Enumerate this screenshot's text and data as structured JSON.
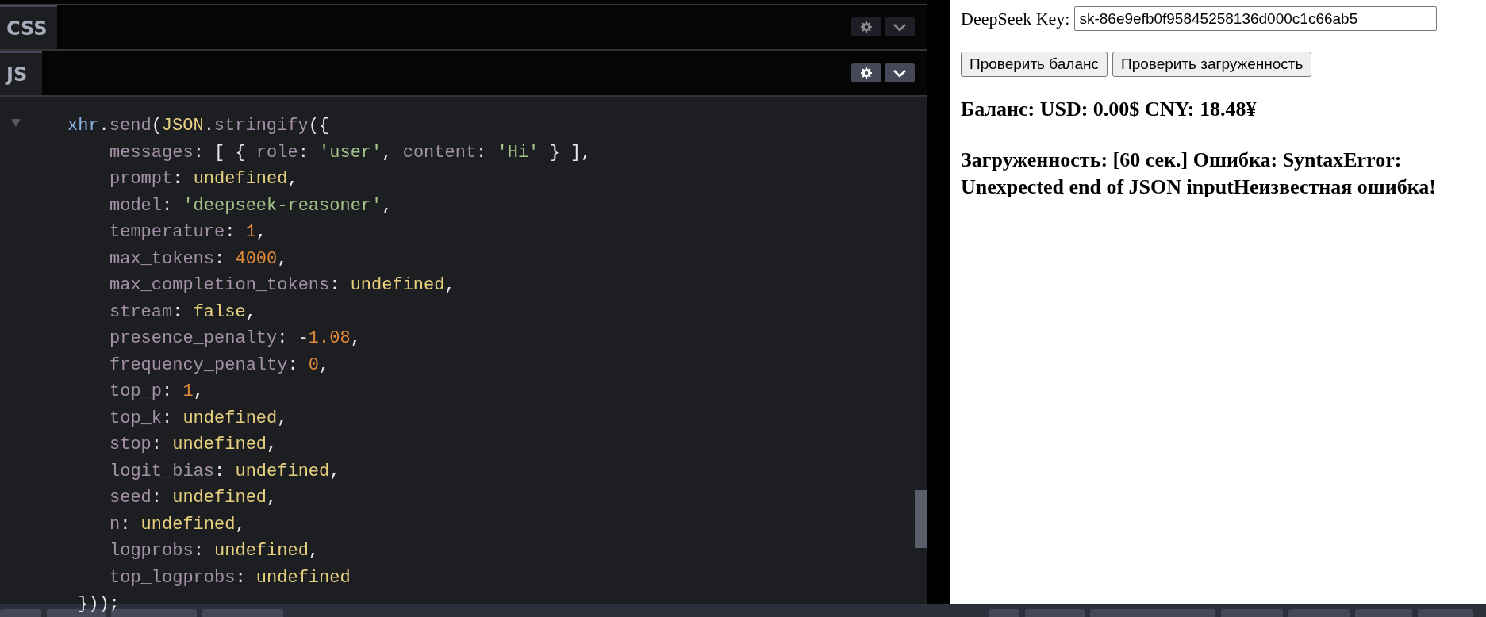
{
  "editor": {
    "panels": [
      {
        "label": "CSS",
        "active": false
      },
      {
        "label": "JS",
        "active": true
      }
    ],
    "code_lines": [
      {
        "kind": "head",
        "tokens": [
          {
            "kind": "var",
            "text": "xhr"
          },
          {
            "kind": "punct",
            "text": "."
          },
          {
            "kind": "prop",
            "text": "send"
          },
          {
            "kind": "punct",
            "text": "("
          },
          {
            "kind": "keyword",
            "text": "JSON"
          },
          {
            "kind": "punct",
            "text": "."
          },
          {
            "kind": "prop",
            "text": "stringify"
          },
          {
            "kind": "punct",
            "text": "({"
          }
        ]
      },
      {
        "kind": "entry",
        "tokens": [
          {
            "kind": "prop",
            "text": "messages"
          },
          {
            "kind": "punct",
            "text": ": [ { "
          },
          {
            "kind": "prop",
            "text": "role"
          },
          {
            "kind": "punct",
            "text": ": "
          },
          {
            "kind": "string",
            "text": "'user'"
          },
          {
            "kind": "punct",
            "text": ", "
          },
          {
            "kind": "prop",
            "text": "content"
          },
          {
            "kind": "punct",
            "text": ": "
          },
          {
            "kind": "string",
            "text": "'Hi'"
          },
          {
            "kind": "punct",
            "text": " } ],"
          }
        ]
      },
      {
        "kind": "entry",
        "tokens": [
          {
            "kind": "prop",
            "text": "prompt"
          },
          {
            "kind": "punct",
            "text": ": "
          },
          {
            "kind": "keyword",
            "text": "undefined"
          },
          {
            "kind": "punct",
            "text": ","
          }
        ]
      },
      {
        "kind": "entry",
        "tokens": [
          {
            "kind": "prop",
            "text": "model"
          },
          {
            "kind": "punct",
            "text": ": "
          },
          {
            "kind": "string",
            "text": "'deepseek-reasoner'"
          },
          {
            "kind": "punct",
            "text": ","
          }
        ]
      },
      {
        "kind": "entry",
        "tokens": [
          {
            "kind": "prop",
            "text": "temperature"
          },
          {
            "kind": "punct",
            "text": ": "
          },
          {
            "kind": "number",
            "text": "1"
          },
          {
            "kind": "punct",
            "text": ","
          }
        ]
      },
      {
        "kind": "entry",
        "tokens": [
          {
            "kind": "prop",
            "text": "max_tokens"
          },
          {
            "kind": "punct",
            "text": ": "
          },
          {
            "kind": "number",
            "text": "4000"
          },
          {
            "kind": "punct",
            "text": ","
          }
        ]
      },
      {
        "kind": "entry",
        "tokens": [
          {
            "kind": "prop",
            "text": "max_completion_tokens"
          },
          {
            "kind": "punct",
            "text": ": "
          },
          {
            "kind": "keyword",
            "text": "undefined"
          },
          {
            "kind": "punct",
            "text": ","
          }
        ]
      },
      {
        "kind": "entry",
        "tokens": [
          {
            "kind": "prop",
            "text": "stream"
          },
          {
            "kind": "punct",
            "text": ": "
          },
          {
            "kind": "keyword",
            "text": "false"
          },
          {
            "kind": "punct",
            "text": ","
          }
        ]
      },
      {
        "kind": "entry",
        "tokens": [
          {
            "kind": "prop",
            "text": "presence_penalty"
          },
          {
            "kind": "punct",
            "text": ": -"
          },
          {
            "kind": "number",
            "text": "1.08"
          },
          {
            "kind": "punct",
            "text": ","
          }
        ]
      },
      {
        "kind": "entry",
        "tokens": [
          {
            "kind": "prop",
            "text": "frequency_penalty"
          },
          {
            "kind": "punct",
            "text": ": "
          },
          {
            "kind": "number",
            "text": "0"
          },
          {
            "kind": "punct",
            "text": ","
          }
        ]
      },
      {
        "kind": "entry",
        "tokens": [
          {
            "kind": "prop",
            "text": "top_p"
          },
          {
            "kind": "punct",
            "text": ": "
          },
          {
            "kind": "number",
            "text": "1"
          },
          {
            "kind": "punct",
            "text": ","
          }
        ]
      },
      {
        "kind": "entry",
        "tokens": [
          {
            "kind": "prop",
            "text": "top_k"
          },
          {
            "kind": "punct",
            "text": ": "
          },
          {
            "kind": "keyword",
            "text": "undefined"
          },
          {
            "kind": "punct",
            "text": ","
          }
        ]
      },
      {
        "kind": "entry",
        "tokens": [
          {
            "kind": "prop",
            "text": "stop"
          },
          {
            "kind": "punct",
            "text": ": "
          },
          {
            "kind": "keyword",
            "text": "undefined"
          },
          {
            "kind": "punct",
            "text": ","
          }
        ]
      },
      {
        "kind": "entry",
        "tokens": [
          {
            "kind": "prop",
            "text": "logit_bias"
          },
          {
            "kind": "punct",
            "text": ": "
          },
          {
            "kind": "keyword",
            "text": "undefined"
          },
          {
            "kind": "punct",
            "text": ","
          }
        ]
      },
      {
        "kind": "entry",
        "tokens": [
          {
            "kind": "prop",
            "text": "seed"
          },
          {
            "kind": "punct",
            "text": ": "
          },
          {
            "kind": "keyword",
            "text": "undefined"
          },
          {
            "kind": "punct",
            "text": ","
          }
        ]
      },
      {
        "kind": "entry",
        "tokens": [
          {
            "kind": "prop",
            "text": "n"
          },
          {
            "kind": "punct",
            "text": ": "
          },
          {
            "kind": "keyword",
            "text": "undefined"
          },
          {
            "kind": "punct",
            "text": ","
          }
        ]
      },
      {
        "kind": "entry",
        "tokens": [
          {
            "kind": "prop",
            "text": "logprobs"
          },
          {
            "kind": "punct",
            "text": ": "
          },
          {
            "kind": "keyword",
            "text": "undefined"
          },
          {
            "kind": "punct",
            "text": ","
          }
        ]
      },
      {
        "kind": "entry",
        "tokens": [
          {
            "kind": "prop",
            "text": "top_logprobs"
          },
          {
            "kind": "punct",
            "text": ": "
          },
          {
            "kind": "keyword",
            "text": "undefined"
          }
        ]
      },
      {
        "kind": "close",
        "tokens": [
          {
            "kind": "punct",
            "text": "}));"
          }
        ]
      }
    ]
  },
  "preview": {
    "key_label": "DeepSeek Key:",
    "key_value": "sk-86e9efb0f95845258136d000c1c66ab5",
    "buttons": [
      "Проверить баланс",
      "Проверить загруженность"
    ],
    "results": [
      "Баланс: USD: 0.00$ CNY: 18.48¥",
      "Загруженность: [60 сек.] Ошибка: SyntaxError: Unexpected end of JSON inputНеизвестная ошибка!"
    ]
  }
}
